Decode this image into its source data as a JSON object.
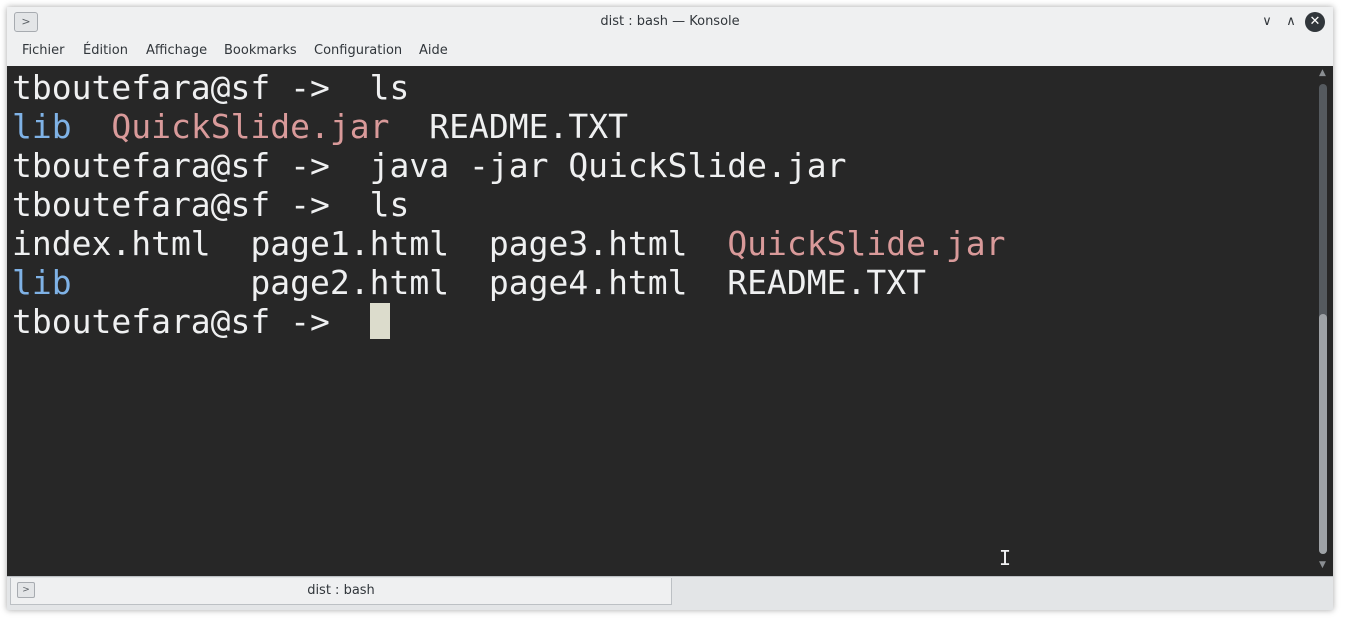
{
  "window": {
    "title": "dist : bash — Konsole",
    "icon": "terminal-icon",
    "controls": {
      "minimize": "∨",
      "maximize": "∧",
      "close": "✕"
    }
  },
  "menubar": {
    "items": [
      "Fichier",
      "Édition",
      "Affichage",
      "Bookmarks",
      "Configuration",
      "Aide"
    ]
  },
  "terminal": {
    "colors": {
      "background": "#272727",
      "foreground": "#eff0f1",
      "directory": "#7fb2e6",
      "archive": "#d99a9a",
      "cursor": "#dcdccc"
    },
    "lines": [
      {
        "prompt": "tboutefara@sf ->",
        "command": "ls"
      },
      {
        "seg": [
          "lib",
          "QuickSlide.jar",
          "README.TXT"
        ]
      },
      {
        "prompt": "tboutefara@sf ->",
        "command": "java -jar QuickSlide.jar"
      },
      {
        "prompt": "tboutefara@sf ->",
        "command": "ls"
      },
      {
        "seg": [
          "index.html",
          "page1.html",
          "page3.html",
          "QuickSlide.jar"
        ]
      },
      {
        "seg": [
          "lib",
          "page2.html",
          "page4.html",
          "README.TXT"
        ]
      },
      {
        "prompt": "tboutefara@sf ->"
      }
    ]
  },
  "tabs": [
    {
      "label": "dist : bash",
      "icon": "terminal-icon"
    }
  ]
}
